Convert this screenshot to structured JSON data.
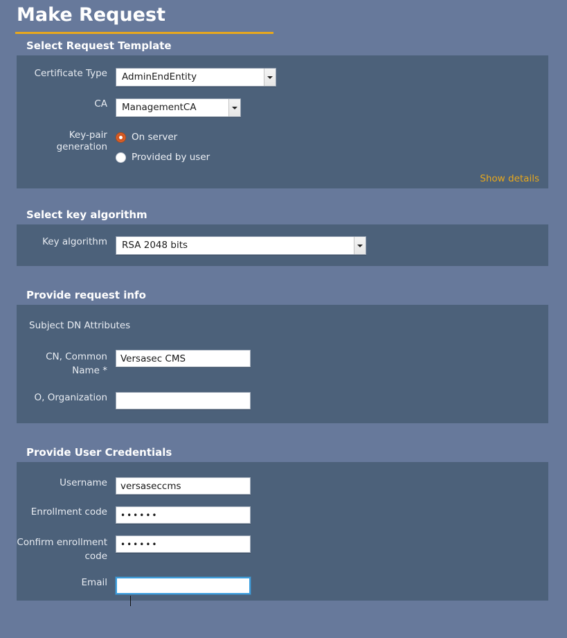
{
  "page": {
    "title": "Make Request",
    "accent_gold": "#e8a81c",
    "background": "#67799b",
    "panel_background": "#4c617a",
    "radio_selected_color": "#d3561f",
    "focus_border_color": "#3ea0e0"
  },
  "sections": {
    "template": {
      "header": "Select Request Template",
      "fields": {
        "certificate_type": {
          "label": "Certificate Type",
          "value": "AdminEndEntity"
        },
        "ca": {
          "label": "CA",
          "value": "ManagementCA"
        },
        "keypair": {
          "label": "Key-pair generation",
          "options": [
            {
              "label": "On server",
              "selected": true
            },
            {
              "label": "Provided by user",
              "selected": false
            }
          ]
        }
      },
      "show_details_link": "Show details"
    },
    "key_algorithm": {
      "header": "Select key algorithm",
      "fields": {
        "key_algorithm": {
          "label": "Key algorithm",
          "value": "RSA 2048 bits"
        }
      }
    },
    "request_info": {
      "header": "Provide request info",
      "subhead": "Subject DN Attributes",
      "fields": {
        "cn": {
          "label": "CN, Common Name *",
          "value": "Versasec CMS",
          "placeholder": ""
        },
        "o": {
          "label": "O, Organization",
          "value": "",
          "placeholder": ""
        }
      }
    },
    "credentials": {
      "header": "Provide User Credentials",
      "fields": {
        "username": {
          "label": "Username",
          "value": "versaseccms",
          "placeholder": ""
        },
        "enrollment_code": {
          "label": "Enrollment code",
          "value": "••••••",
          "placeholder": ""
        },
        "confirm_enrollment_code": {
          "label": "Confirm enrollment code",
          "value": "••••••",
          "placeholder": ""
        },
        "email": {
          "label": "Email",
          "value": "",
          "placeholder": "",
          "focused": true
        }
      }
    }
  },
  "icons": {
    "dropdown_arrow": "chevron-down-icon"
  }
}
